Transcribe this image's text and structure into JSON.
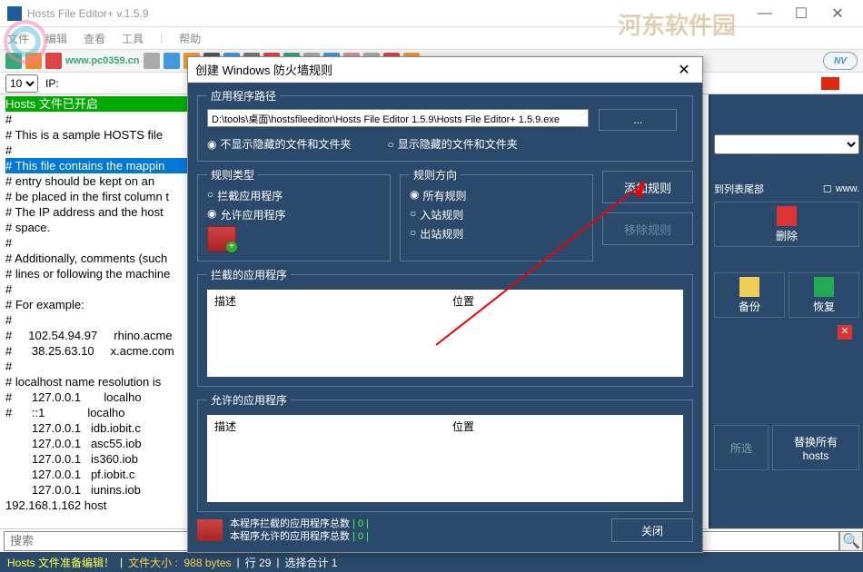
{
  "window": {
    "title": "Hosts File Editor+ v.1.5.9",
    "watermark": "河东软件园"
  },
  "menu": {
    "file": "文件",
    "edit": "编辑",
    "view": "查看",
    "tools": "工具",
    "help": "帮助",
    "pc_wm": "www.pc0359.cn"
  },
  "subbar": {
    "num": "10",
    "ip_label": "IP:"
  },
  "editor": {
    "l0": "Hosts 文件已开启",
    "l1": "#",
    "l2": "# This is a sample HOSTS file",
    "l3": "#",
    "l4": "# This file contains the mappin",
    "l5": "# entry should be kept on an",
    "l6": "# be placed in the first column t",
    "l7": "# The IP address and the host",
    "l8": "# space.",
    "l9": "#",
    "l10": "# Additionally, comments (such",
    "l11": "# lines or following the machine",
    "l12": "#",
    "l13": "# For example:",
    "l14": "#",
    "l15": "#     102.54.94.97     rhino.acme",
    "l16": "#      38.25.63.10     x.acme.com",
    "l17": "#",
    "l18": "# localhost name resolution is",
    "l19": "#\t127.0.0.1       localho",
    "l20": "#\t::1             localho",
    "l21": "\t127.0.0.1   idb.iobit.c",
    "l22": "\t127.0.0.1   asc55.iob",
    "l23": "\t127.0.0.1   is360.iob",
    "l24": "\t127.0.0.1   pf.iobit.c",
    "l25": "\t127.0.0.1   iunins.iob",
    "l26": "",
    "l27": "192.168.1.162 host"
  },
  "right": {
    "label_end": "到列表尾部",
    "chk_www": "www.",
    "del": "删除",
    "backup": "备份",
    "restore": "恢复",
    "replace1": "替换所有",
    "replace2": "hosts",
    "resel_suffix": "所选"
  },
  "search": {
    "placeholder": "搜索"
  },
  "status": {
    "ready": "Hosts 文件准备编辑！",
    "size_lbl": "文件大小 :",
    "size_val": "988 bytes",
    "line_lbl": "行",
    "line_val": "29",
    "sel_lbl": "选择合计",
    "sel_val": "1"
  },
  "modal": {
    "title": "创建  Windows 防火墙规则",
    "path_legend": "应用程序路径",
    "path": "D:\\tools\\桌面\\hostsfileeditor\\Hosts File Editor 1.5.9\\Hosts File Editor+ 1.5.9.exe",
    "browse": "...",
    "hide_off": "不显示隐藏的文件和文件夹",
    "hide_on": "显示隐藏的文件和文件夹",
    "type_legend": "规则类型",
    "type_block": "拦截应用程序",
    "type_allow": "允许应用程序",
    "dir_legend": "规则方向",
    "dir_all": "所有规则",
    "dir_in": "入站规则",
    "dir_out": "出站规则",
    "add_rule": "添加规则",
    "remove_rule": "移除规则",
    "blocked_legend": "拦截的应用程序",
    "allowed_legend": "允许的应用程序",
    "col_desc": "描述",
    "col_loc": "位置",
    "sum_block": "本程序拦截的应用程序总数",
    "sum_allow": "本程序允许的应用程序总数",
    "sum_zero": " | 0 |",
    "close": "关闭"
  }
}
